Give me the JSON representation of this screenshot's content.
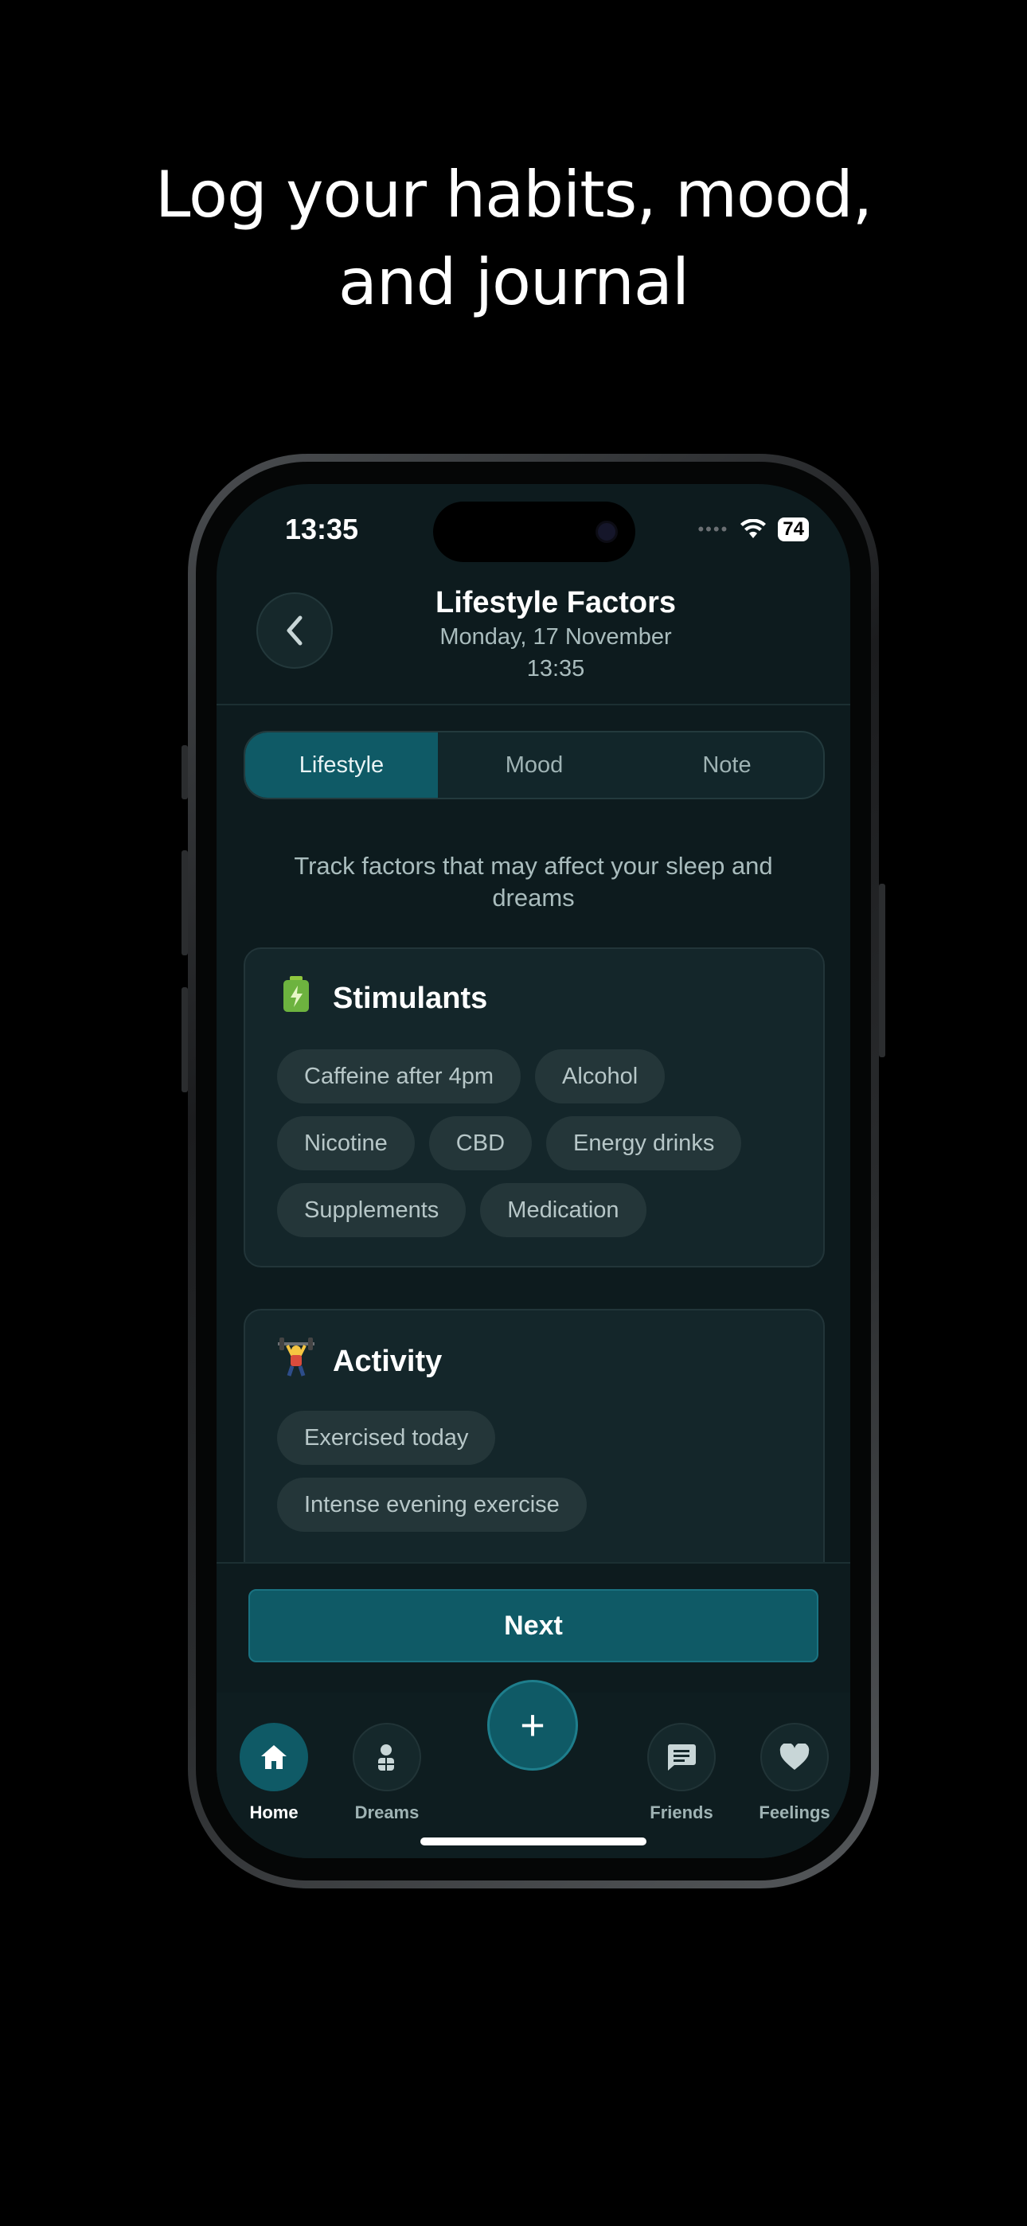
{
  "headline": {
    "line1": "Log your habits, mood,",
    "line2": "and journal"
  },
  "status_bar": {
    "time": "13:35",
    "battery": "74"
  },
  "header": {
    "title": "Lifestyle Factors",
    "date": "Monday, 17 November",
    "time": "13:35"
  },
  "tabs": [
    {
      "label": "Lifestyle",
      "active": true
    },
    {
      "label": "Mood",
      "active": false
    },
    {
      "label": "Note",
      "active": false
    }
  ],
  "intro": "Track factors that may affect your sleep and dreams",
  "sections": [
    {
      "title": "Stimulants",
      "icon": "battery-icon",
      "chips": [
        "Caffeine after 4pm",
        "Alcohol",
        "Nicotine",
        "CBD",
        "Energy drinks",
        "Supplements",
        "Medication"
      ]
    },
    {
      "title": "Activity",
      "icon": "weightlifter-icon",
      "chips": [
        "Exercised today",
        "Intense evening exercise"
      ]
    }
  ],
  "next_label": "Next",
  "nav": {
    "home": "Home",
    "dreams": "Dreams",
    "friends": "Friends",
    "feelings": "Feelings",
    "add": "+"
  },
  "colors": {
    "accent": "#0f5a66",
    "background": "#0d1b1e",
    "card": "#14262a",
    "chip": "#243639"
  }
}
